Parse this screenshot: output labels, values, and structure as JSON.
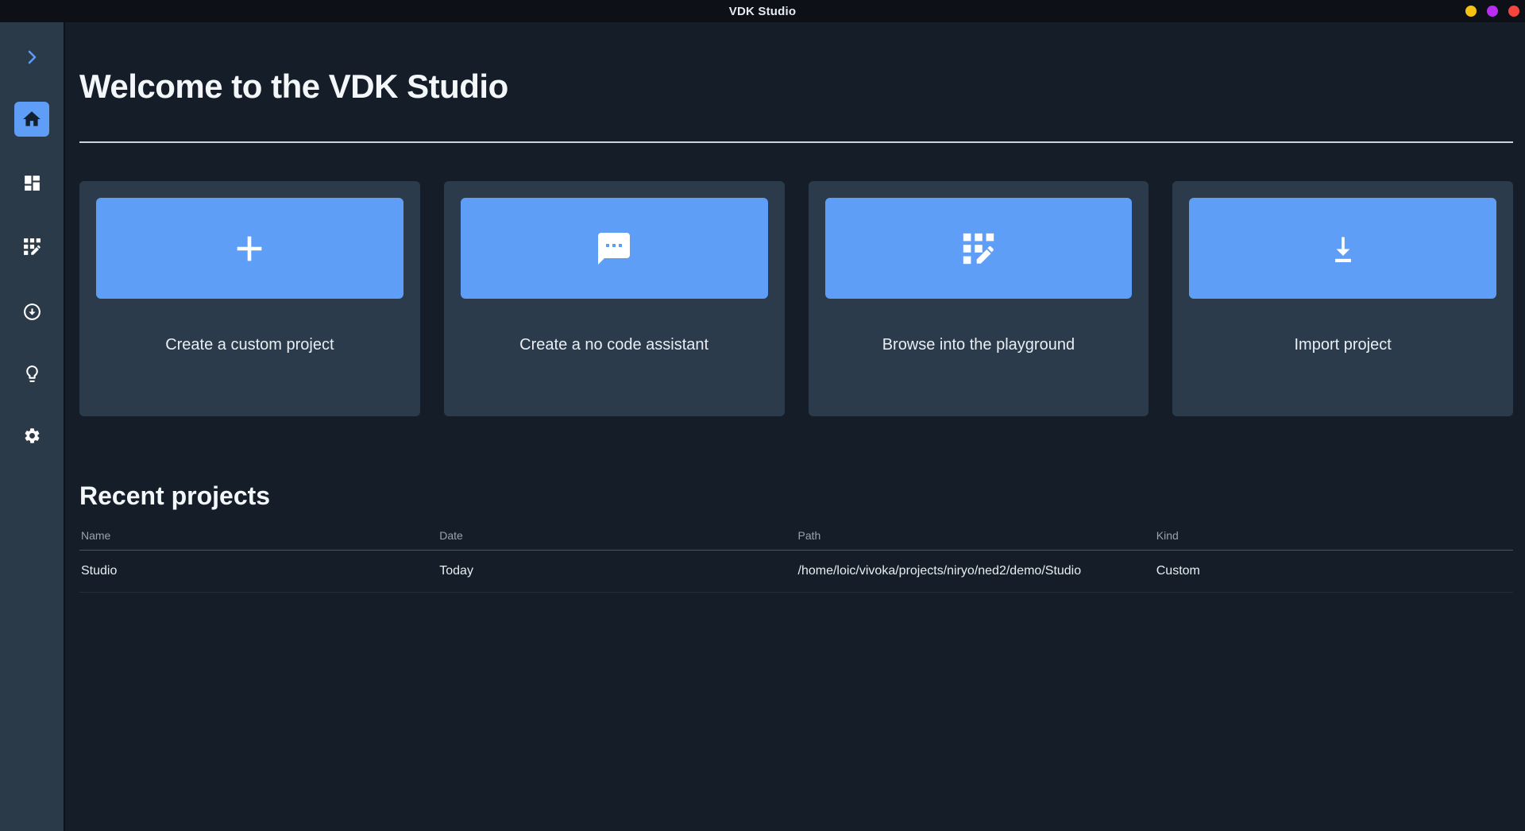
{
  "window": {
    "title": "VDK Studio",
    "controls": [
      {
        "name": "minimize-dot",
        "color": "#f5c211"
      },
      {
        "name": "maximize-dot",
        "color": "#b92df2"
      },
      {
        "name": "close-dot",
        "color": "#f6453e"
      }
    ]
  },
  "colors": {
    "accent_blue": "#5f9ef7",
    "titlebar_bg": "#0d1016",
    "sidebar_bg": "#2b3a49",
    "content_bg": "#151e28",
    "card_bg": "#2b3b4b",
    "divider_light": "#ccd3db"
  },
  "sidebar": {
    "items": [
      {
        "id": "expand",
        "icon": "chevron-right-icon",
        "active": false
      },
      {
        "id": "home",
        "icon": "home-icon",
        "active": true
      },
      {
        "id": "dashboard",
        "icon": "dashboard-icon",
        "active": false
      },
      {
        "id": "models",
        "icon": "app-registration-icon",
        "active": false
      },
      {
        "id": "downloads",
        "icon": "download-circle-icon",
        "active": false
      },
      {
        "id": "ideas",
        "icon": "lightbulb-icon",
        "active": false
      },
      {
        "id": "settings",
        "icon": "gear-icon",
        "active": false
      }
    ]
  },
  "main": {
    "welcome_title": "Welcome to the VDK Studio",
    "cards": [
      {
        "label": "Create a custom project",
        "icon": "plus-icon"
      },
      {
        "label": "Create a no code assistant",
        "icon": "chat-icon"
      },
      {
        "label": "Browse into the playground",
        "icon": "app-registration-icon"
      },
      {
        "label": "Import project",
        "icon": "download-icon"
      }
    ],
    "recent_projects": {
      "title": "Recent projects",
      "columns": [
        "Name",
        "Date",
        "Path",
        "Kind"
      ],
      "rows": [
        {
          "name": "Studio",
          "date": "Today",
          "path": "/home/loic/vivoka/projects/niryo/ned2/demo/Studio",
          "kind": "Custom"
        }
      ]
    }
  }
}
